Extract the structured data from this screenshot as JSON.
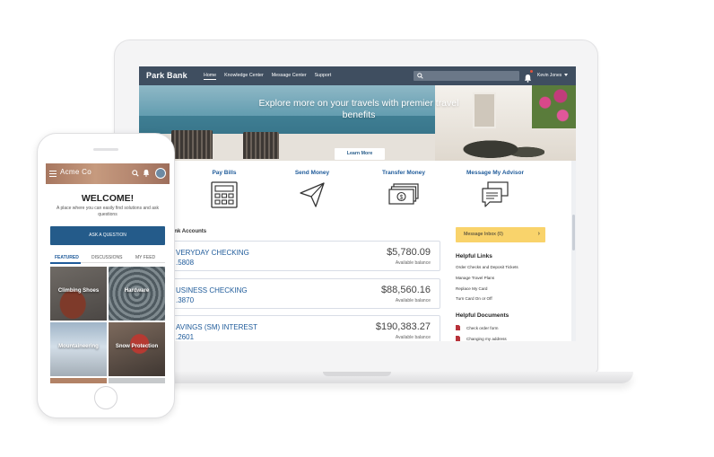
{
  "laptop": {
    "brand": "Park Bank",
    "nav": [
      "Home",
      "Knowledge Center",
      "Message Center",
      "Support"
    ],
    "user_name": "Kevin Jones",
    "hero": {
      "title": "Explore more on your travels with premier travel benefits",
      "button": "Learn More"
    },
    "actions": [
      "Pay Bills",
      "Send Money",
      "Transfer Money",
      "Message My Advisor"
    ],
    "accounts_heading": "ank Accounts",
    "accounts": [
      {
        "name": "VERYDAY CHECKING",
        "number": ".5808",
        "amount": "$5,780.09",
        "sub": "Available balance"
      },
      {
        "name": "USINESS CHECKING",
        "number": ".3870",
        "amount": "$88,560.16",
        "sub": "Available balance"
      },
      {
        "name": "AVINGS (SM) INTEREST",
        "number": ".2601",
        "amount": "$190,383.27",
        "sub": "Available balance"
      }
    ],
    "inbox_button": "Message Inbox (0)",
    "helpful_links_heading": "Helpful Links",
    "helpful_links": [
      "Order Checks and Deposit Tickets",
      "Manage Travel Plans",
      "Replace My Card",
      "Turn Card On or Off"
    ],
    "helpful_docs_heading": "Helpful Documents",
    "helpful_docs": [
      "Check order form",
      "Changing my address"
    ]
  },
  "phone": {
    "brand": "Acme Co",
    "welcome": "WELCOME!",
    "subtitle": "A place where you can easily find solutions and ask questions",
    "ask_button": "ASK A QUESTION",
    "tabs": [
      "FEATURED",
      "DISCUSSIONS",
      "MY FEED"
    ],
    "tiles": [
      "Climbing Shoes",
      "Hardware",
      "Mountaineering",
      "Snow Protection"
    ]
  },
  "colors": {
    "nav_bg": "#3f4e60",
    "accent_blue": "#1f5b9a",
    "inbox_yellow": "#f9d36b",
    "phone_button": "#245b8a"
  }
}
